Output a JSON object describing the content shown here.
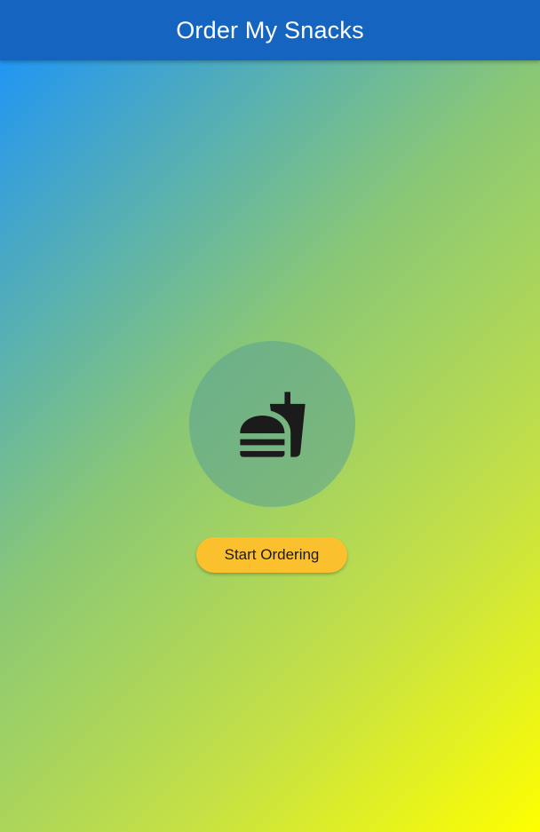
{
  "app_bar": {
    "title": "Order My Snacks",
    "background": "#1565C0"
  },
  "main": {
    "icon": "fastfood-icon",
    "start_button_label": "Start Ordering",
    "button_color": "#FBC02D",
    "gradient": [
      "#2196F3",
      "#FFFF00"
    ]
  }
}
